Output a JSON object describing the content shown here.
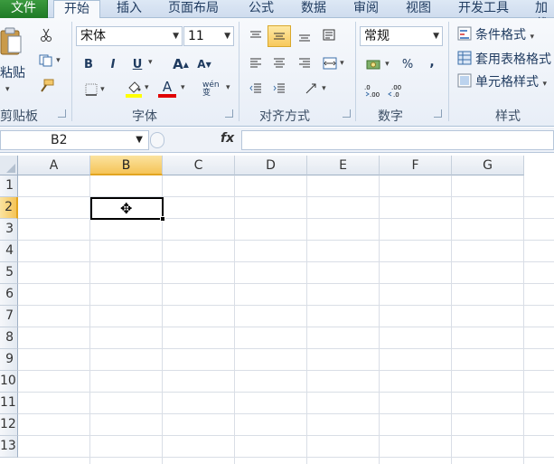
{
  "tabs": {
    "file": "文件",
    "home": "开始",
    "insert": "插入",
    "page_layout": "页面布局",
    "formulas": "公式",
    "data": "数据",
    "review": "审阅",
    "view": "视图",
    "developer": "开发工具",
    "addins": "加载"
  },
  "clipboard": {
    "paste_label": "粘贴",
    "group_label": "剪贴板"
  },
  "font": {
    "name": "宋体",
    "size": "11",
    "bold": "B",
    "italic": "I",
    "underline": "U",
    "grow": "A",
    "shrink": "A",
    "font_color": "A",
    "phonetic": "wén 变",
    "group_label": "字体"
  },
  "alignment": {
    "group_label": "对齐方式"
  },
  "number": {
    "format": "常规",
    "percent": "%",
    "comma": ",",
    "group_label": "数字"
  },
  "styles": {
    "conditional": "条件格式",
    "table": "套用表格格式",
    "cell": "单元格样式",
    "group_label": "样式"
  },
  "formula_bar": {
    "name_box": "B2",
    "fx": "fx",
    "formula": ""
  },
  "grid": {
    "columns": [
      "A",
      "B",
      "C",
      "D",
      "E",
      "F",
      "G"
    ],
    "rows": [
      "1",
      "2",
      "3",
      "4",
      "5",
      "6",
      "7",
      "8",
      "9",
      "10",
      "11",
      "12",
      "13"
    ],
    "selected_column": "B",
    "selected_row": "2"
  },
  "colors": {
    "file_tab": "#2a8a30",
    "selection_highlight": "#f5c457",
    "highlight_yellow": "#ffff00",
    "font_red": "#e00000"
  }
}
